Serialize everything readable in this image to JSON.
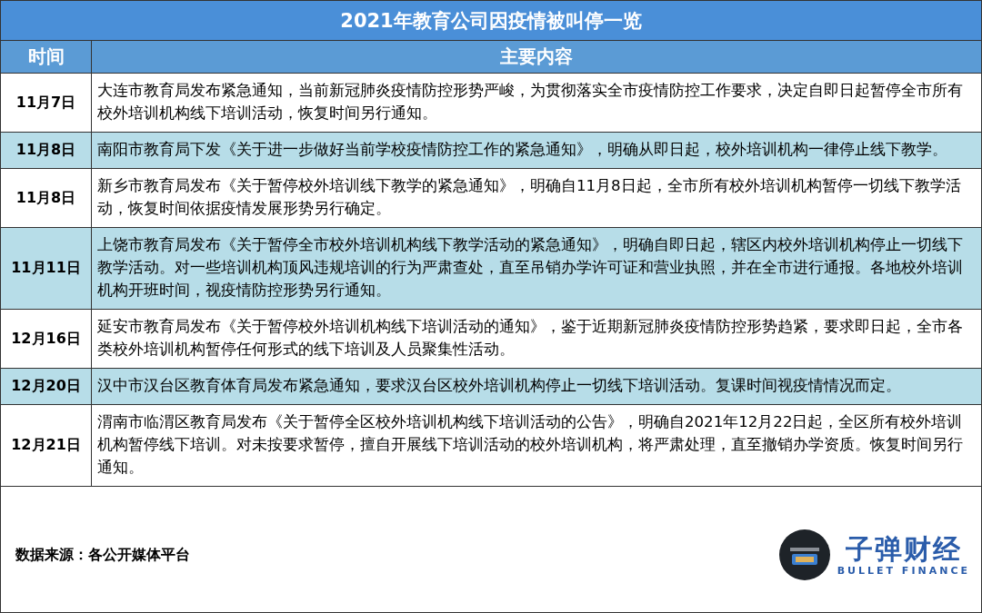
{
  "title": "2021年教育公司因疫情被叫停一览",
  "columns": [
    "时间",
    "主要内容"
  ],
  "rows": [
    {
      "date": "11月7日",
      "content": "大连市教育局发布紧急通知，当前新冠肺炎疫情防控形势严峻，为贯彻落实全市疫情防控工作要求，决定自即日起暂停全市所有校外培训机构线下培训活动，恢复时间另行通知。"
    },
    {
      "date": "11月8日",
      "content": "南阳市教育局下发《关于进一步做好当前学校疫情防控工作的紧急通知》，明确从即日起，校外培训机构一律停止线下教学。"
    },
    {
      "date": "11月8日",
      "content": "新乡市教育局发布《关于暂停校外培训线下教学的紧急通知》，明确自11月8日起，全市所有校外培训机构暂停一切线下教学活动，恢复时间依据疫情发展形势另行确定。"
    },
    {
      "date": "11月11日",
      "content": "上饶市教育局发布《关于暂停全市校外培训机构线下教学活动的紧急通知》，明确自即日起，辖区内校外培训机构停止一切线下教学活动。对一些培训机构顶风违规培训的行为严肃查处，直至吊销办学许可证和营业执照，并在全市进行通报。各地校外培训机构开班时间，视疫情防控形势另行通知。"
    },
    {
      "date": "12月16日",
      "content": "延安市教育局发布《关于暂停校外培训机构线下培训活动的通知》，鉴于近期新冠肺炎疫情防控形势趋紧，要求即日起，全市各类校外培训机构暂停任何形式的线下培训及人员聚集性活动。"
    },
    {
      "date": "12月20日",
      "content": "汉中市汉台区教育体育局发布紧急通知，要求汉台区校外培训机构停止一切线下培训活动。复课时间视疫情情况而定。"
    },
    {
      "date": "12月21日",
      "content": "渭南市临渭区教育局发布《关于暂停全区校外培训机构线下培训活动的公告》，明确自2021年12月22日起，全区所有校外培训机构暂停线下培训。对未按要求暂停，擅自开展线下培训活动的校外培训机构，将严肃处理，直至撤销办学资质。恢复时间另行通知。"
    }
  ],
  "source": "数据来源：各公开媒体平台",
  "logo": {
    "name": "子弹财经",
    "subtitle": "BULLET FINANCE"
  }
}
